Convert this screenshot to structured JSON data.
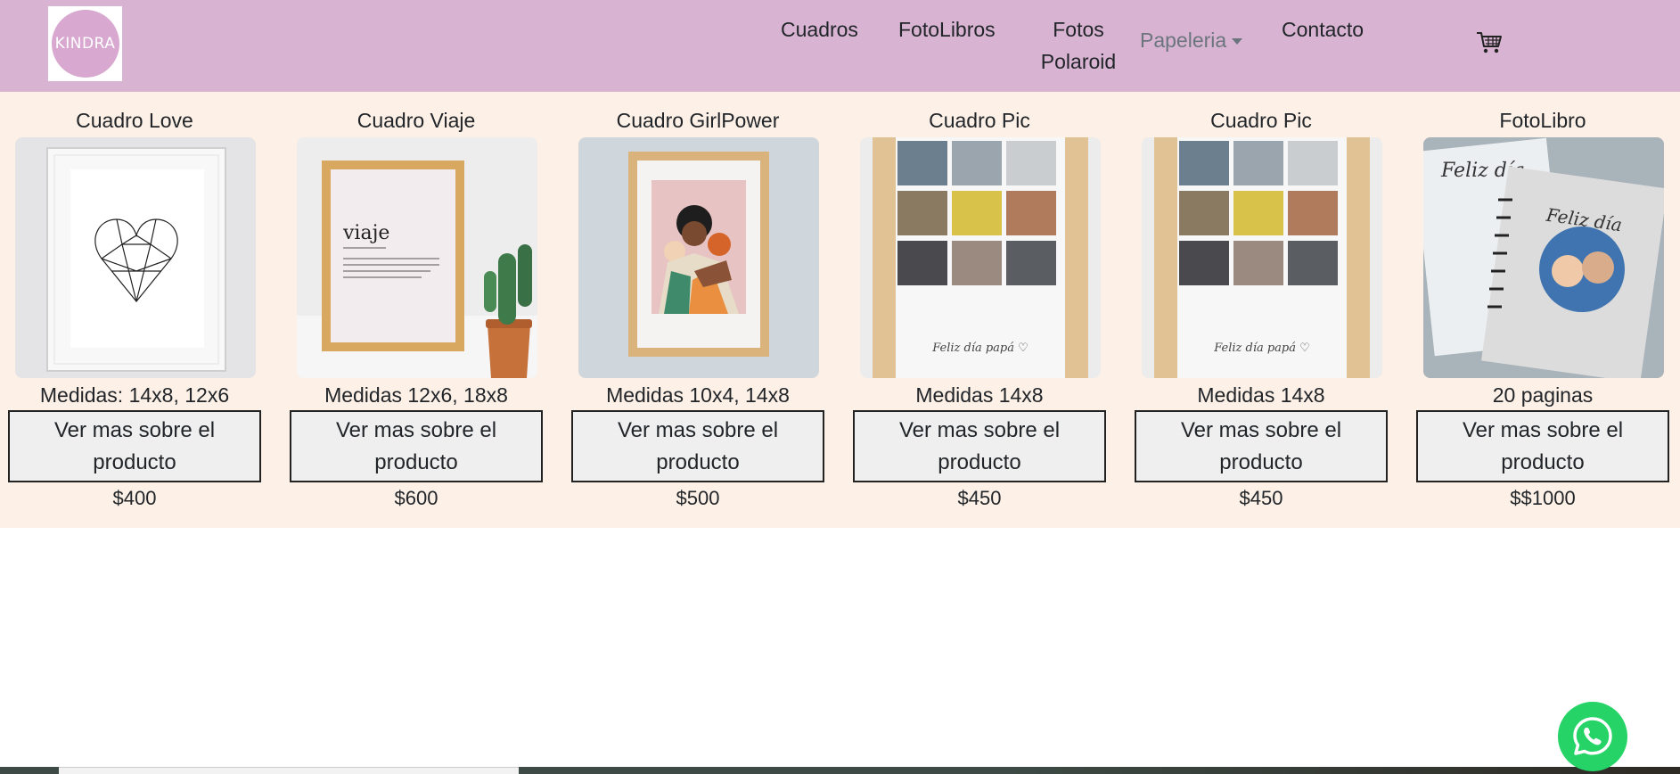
{
  "brand": {
    "logo_text": "KINDRA"
  },
  "nav": {
    "cuadros": "Cuadros",
    "fotolibros": "FotoLibros",
    "polaroid_line1": "Fotos",
    "polaroid_line2": "Polaroid",
    "papeleria": "Papeleria",
    "contacto": "Contacto"
  },
  "colors": {
    "navbar": "#d8b4d2",
    "strip": "#fdf0e6",
    "whatsapp": "#25d366"
  },
  "products": [
    {
      "title": "Cuadro Love",
      "subtitle": "Medidas: 14x8, 12x6",
      "button": "Ver mas sobre el producto",
      "price": "$400"
    },
    {
      "title": "Cuadro Viaje",
      "subtitle": "Medidas 12x6, 18x8",
      "button": "Ver mas sobre el producto",
      "price": "$600"
    },
    {
      "title": "Cuadro GirlPower",
      "subtitle": "Medidas 10x4, 14x8",
      "button": "Ver mas sobre el producto",
      "price": "$500"
    },
    {
      "title": "Cuadro Pic",
      "subtitle": "Medidas 14x8",
      "button": "Ver mas sobre el producto",
      "price": "$450"
    },
    {
      "title": "Cuadro Pic",
      "subtitle": "Medidas 14x8",
      "button": "Ver mas sobre el producto",
      "price": "$450"
    },
    {
      "title": "FotoLibro",
      "subtitle": "20 paginas",
      "button": "Ver mas sobre el producto",
      "price": "$$1000"
    }
  ],
  "images": {
    "viaje_word": "viaje",
    "pic_caption": "Feliz día papá ♡",
    "fotolibro_caption": "Feliz día"
  },
  "icons": {
    "cart": "cart-icon",
    "whatsapp": "whatsapp-icon",
    "caret": "caret-down-icon"
  }
}
